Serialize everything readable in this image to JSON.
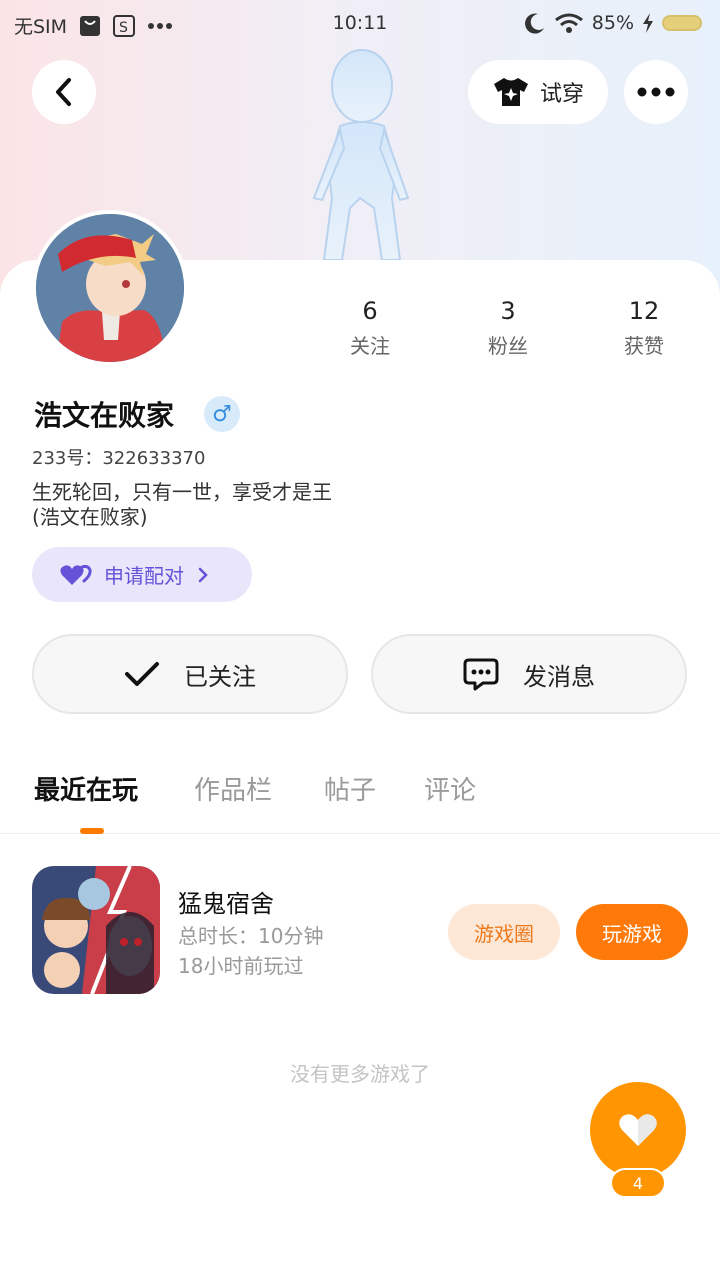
{
  "status_bar": {
    "carrier": "无SIM",
    "time": "10:11",
    "battery": "85%"
  },
  "header": {
    "tryon_label": "试穿",
    "icons": [
      "back-icon",
      "shirt-icon",
      "more-icon"
    ]
  },
  "stats": [
    {
      "num": "6",
      "label": "关注"
    },
    {
      "num": "3",
      "label": "粉丝"
    },
    {
      "num": "12",
      "label": "获赞"
    }
  ],
  "profile": {
    "nickname": "浩文在败家",
    "gender_symbol": "♂",
    "id_line": "233号：322633370",
    "bio_line1": "生死轮回，只有一世，享受才是王",
    "bio_line2": "(浩文在败家)"
  },
  "match_button": {
    "label": "申请配对"
  },
  "actions": {
    "follow_label": "已关注",
    "message_label": "发消息"
  },
  "tabs": [
    {
      "label": "最近在玩",
      "active": true
    },
    {
      "label": "作品栏",
      "active": false
    },
    {
      "label": "帖子",
      "active": false
    },
    {
      "label": "评论",
      "active": false
    }
  ],
  "games": [
    {
      "name": "猛鬼宿舍",
      "duration": "总时长：10分钟",
      "last_played": "18小时前玩过",
      "circle_label": "游戏圈",
      "play_label": "玩游戏"
    }
  ],
  "footer_note": "没有更多游戏了",
  "like": {
    "count": "4"
  },
  "colors": {
    "accent_orange": "#ff7a0a",
    "match_purple": "#6453d8",
    "gender_blue": "#3a8fdc"
  }
}
